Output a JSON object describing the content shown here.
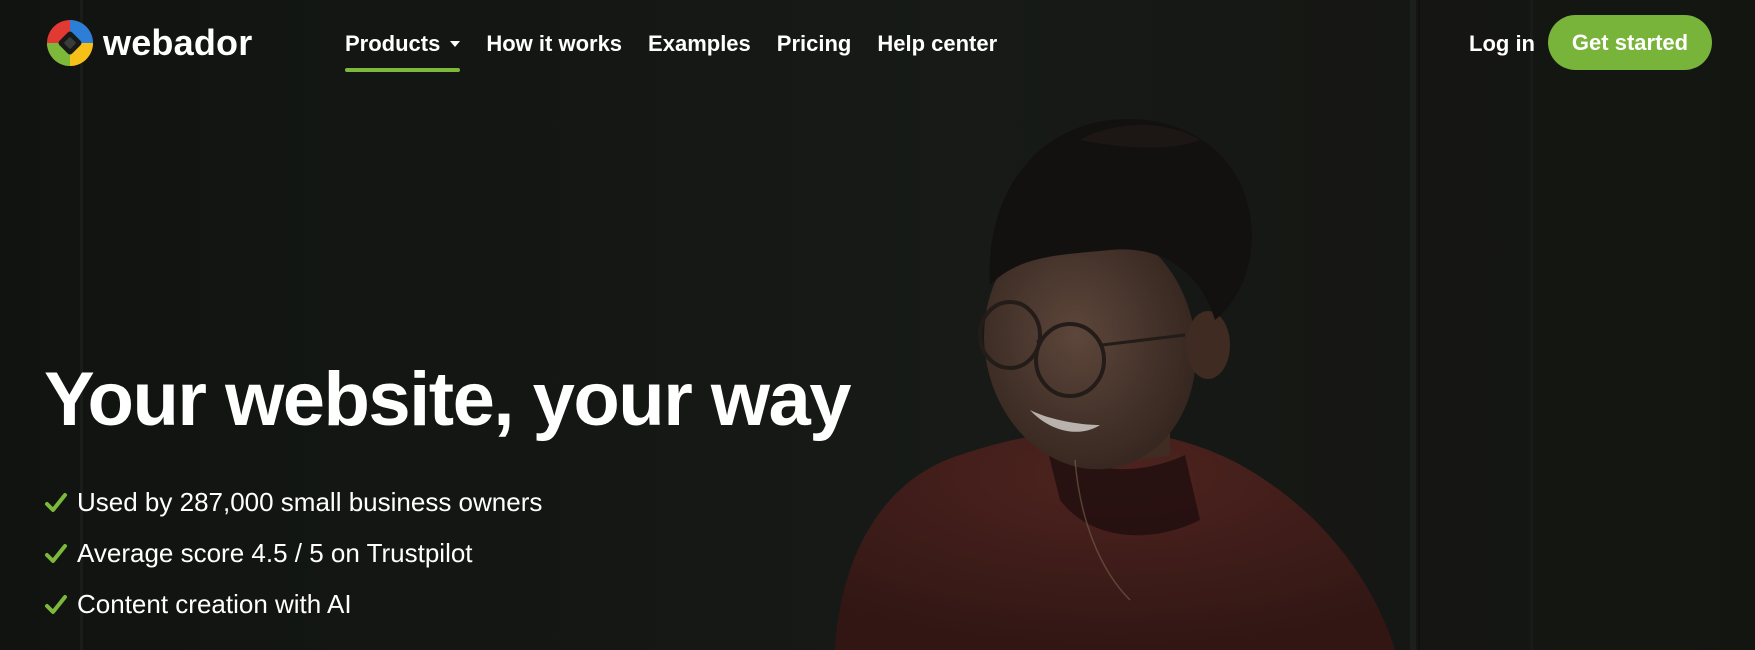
{
  "brand": {
    "name": "webador",
    "logo_icon": "webador-logo-icon",
    "accent_color": "#7cb93a"
  },
  "nav": {
    "items": [
      {
        "label": "Products",
        "active": true,
        "has_dropdown": true
      },
      {
        "label": "How it works"
      },
      {
        "label": "Examples"
      },
      {
        "label": "Pricing"
      },
      {
        "label": "Help center"
      }
    ],
    "login_label": "Log in",
    "cta_label": "Get started",
    "cta_color": "#78b33a"
  },
  "hero": {
    "title": "Your website, your way",
    "features": [
      "Used by 287,000 small business owners",
      "Average score 4.5 / 5 on Trustpilot",
      "Content creation with AI"
    ],
    "feature_icon": "check-icon",
    "photo": "smiling-person-with-glasses-photo"
  }
}
